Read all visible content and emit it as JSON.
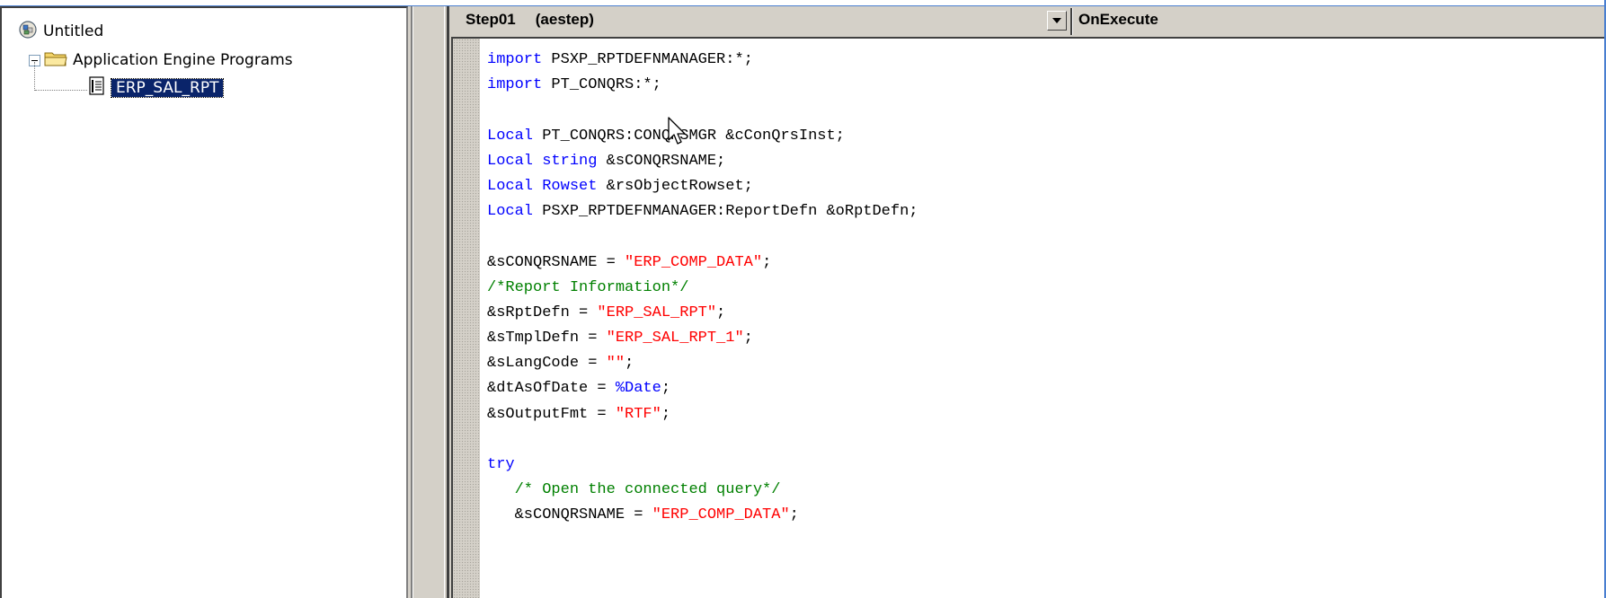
{
  "tree": {
    "root_label": "Untitled",
    "folder_label": "Application Engine Programs",
    "item_label": "ERP_SAL_RPT"
  },
  "header": {
    "object_name": "Step01",
    "object_type": "(aestep)",
    "event": "OnExecute"
  },
  "code_lines": [
    [
      {
        "t": "import",
        "c": "kw"
      },
      {
        "t": " PSXP_RPTDEFNMANAGER:*;"
      }
    ],
    [
      {
        "t": "import",
        "c": "kw"
      },
      {
        "t": " PT_CONQRS:*;"
      }
    ],
    [],
    [
      {
        "t": "Local",
        "c": "kw"
      },
      {
        "t": " PT_CONQRS:CONQRSMGR &cConQrsInst;"
      }
    ],
    [
      {
        "t": "Local",
        "c": "kw"
      },
      {
        "t": " "
      },
      {
        "t": "string",
        "c": "kw"
      },
      {
        "t": " &sCONQRSNAME;"
      }
    ],
    [
      {
        "t": "Local",
        "c": "kw"
      },
      {
        "t": " "
      },
      {
        "t": "Rowset",
        "c": "kw"
      },
      {
        "t": " &rsObjectRowset;"
      }
    ],
    [
      {
        "t": "Local",
        "c": "kw"
      },
      {
        "t": " PSXP_RPTDEFNMANAGER:ReportDefn &oRptDefn;"
      }
    ],
    [],
    [
      {
        "t": "&sCONQRSNAME = "
      },
      {
        "t": "\"ERP_COMP_DATA\"",
        "c": "str"
      },
      {
        "t": ";"
      }
    ],
    [
      {
        "t": "/*Report Information*/",
        "c": "cm"
      }
    ],
    [
      {
        "t": "&sRptDefn = "
      },
      {
        "t": "\"ERP_SAL_RPT\"",
        "c": "str"
      },
      {
        "t": ";"
      }
    ],
    [
      {
        "t": "&sTmplDefn = "
      },
      {
        "t": "\"ERP_SAL_RPT_1\"",
        "c": "str"
      },
      {
        "t": ";"
      }
    ],
    [
      {
        "t": "&sLangCode = "
      },
      {
        "t": "\"\"",
        "c": "str"
      },
      {
        "t": ";"
      }
    ],
    [
      {
        "t": "&dtAsOfDate = "
      },
      {
        "t": "%Date",
        "c": "kw"
      },
      {
        "t": ";"
      }
    ],
    [
      {
        "t": "&sOutputFmt = "
      },
      {
        "t": "\"RTF\"",
        "c": "str"
      },
      {
        "t": ";"
      }
    ],
    [],
    [
      {
        "t": "try",
        "c": "kw"
      }
    ],
    [
      {
        "t": "   "
      },
      {
        "t": "/* Open the connected query*/",
        "c": "cm"
      }
    ],
    [
      {
        "t": "   &sCONQRSNAME = "
      },
      {
        "t": "\"ERP_COMP_DATA\"",
        "c": "str"
      },
      {
        "t": ";"
      }
    ]
  ],
  "colors": {
    "keyword": "#0000ff",
    "string": "#ff0000",
    "comment": "#008000",
    "selection": "#0a246a"
  },
  "icons": [
    "project-icon",
    "folder-icon",
    "program-icon",
    "dropdown-arrow-icon",
    "mouse-cursor-icon"
  ]
}
